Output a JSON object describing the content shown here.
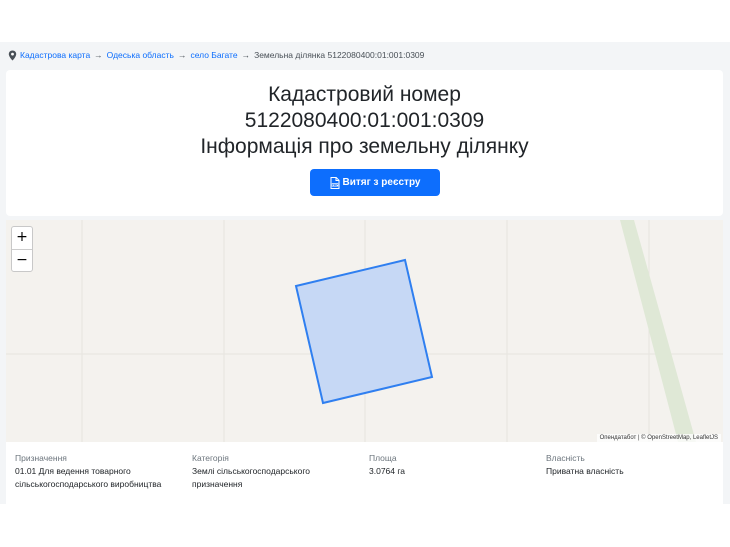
{
  "breadcrumb": {
    "items": [
      "Кадастрова карта",
      "Одеська область",
      "село Багате"
    ],
    "separator": "→",
    "current": "Земельна ділянка 5122080400:01:001:0309"
  },
  "header": {
    "title_line1": "Кадастровий номер",
    "title_line2": "5122080400:01:001:0309",
    "title_line3": "Інформація про земельну ділянку",
    "extract_button": "Витяг з реєстру",
    "extract_icon": "pdf-file-icon"
  },
  "map": {
    "zoom_in": "+",
    "zoom_out": "−",
    "attribution_prefix": "Опендатабот",
    "attribution_sep": " | © ",
    "attribution_osm": "OpenStreetMap",
    "attribution_sep2": ", ",
    "attribution_leaflet": "LeafletJS",
    "parcel_fill": "#c6d8f5",
    "parcel_stroke": "#2f7ff0"
  },
  "info": {
    "purpose_label": "Призначення",
    "purpose_line1": "01.01 Для ведення товарного",
    "purpose_line2": "сільськогосподарського виробництва",
    "category_label": "Категорія",
    "category_line1": "Землі сільськогосподарського",
    "category_line2": "призначення",
    "area_label": "Площа",
    "area_value": "3.0764 га",
    "ownership_label": "Власність",
    "ownership_value": "Приватна власність"
  }
}
